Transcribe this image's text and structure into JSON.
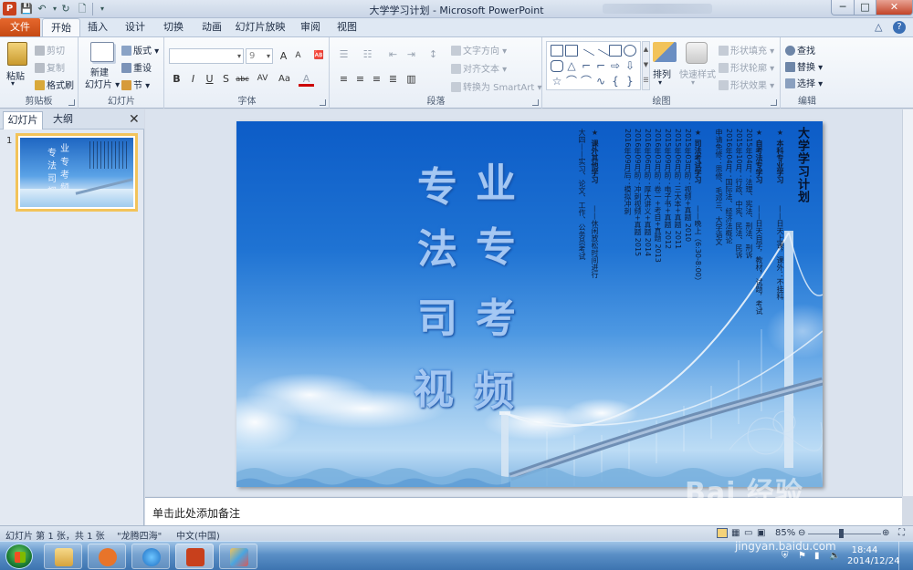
{
  "window": {
    "title": "大学学习计划 - Microsoft PowerPoint",
    "app_icon": "P",
    "controls": {
      "minimize": "─",
      "maximize": "□",
      "close": "✕"
    }
  },
  "qat": {
    "save": "💾",
    "undo": "↶",
    "undo_dd": "▾",
    "redo": "↻",
    "new": "🗋",
    "customize": "▾"
  },
  "tabs": [
    "文件",
    "开始",
    "插入",
    "设计",
    "切换",
    "动画",
    "幻灯片放映",
    "审阅",
    "视图"
  ],
  "active_tab": "开始",
  "ribbon_right": {
    "collapse": "△",
    "help": "?"
  },
  "ribbon": {
    "clipboard": {
      "label": "剪贴板",
      "paste": "粘贴",
      "cut": "剪切",
      "copy": "复制",
      "format_painter": "格式刷"
    },
    "slides": {
      "label": "幻灯片",
      "new_slide_1": "新建",
      "new_slide_2": "幻灯片",
      "layout": "版式",
      "reset": "重设",
      "section": "节"
    },
    "font": {
      "label": "字体",
      "font_name": "",
      "font_size": "9",
      "grow": "A",
      "shrink": "A",
      "clear": "🆎",
      "bold": "B",
      "italic": "I",
      "underline": "U",
      "shadow": "S",
      "strike": "abc",
      "spacing": "AV",
      "case": "Aa",
      "color": "A"
    },
    "paragraph": {
      "label": "段落",
      "text_direction": "文字方向",
      "align_text": "对齐文本",
      "smartart": "转换为 SmartArt"
    },
    "drawing": {
      "label": "绘图",
      "arrange": "排列",
      "quick_styles": "快速样式",
      "shape_fill": "形状填充",
      "shape_outline": "形状轮廓",
      "shape_effects": "形状效果"
    },
    "editing": {
      "label": "编辑",
      "find": "查找",
      "replace": "替换",
      "select": "选择"
    }
  },
  "panel": {
    "tab_slides": "幻灯片",
    "tab_outline": "大纲",
    "close": "✕",
    "slide_number": "1"
  },
  "slide": {
    "left_chars": [
      "专",
      "法",
      "司",
      "视"
    ],
    "right_chars": [
      "业",
      "专",
      "考",
      "频"
    ],
    "title": "大学学习计划",
    "sections": [
      {
        "heading": "★ 本科专业学习",
        "lines": [
          "——日天上课，课外：不挂科"
        ]
      },
      {
        "heading": "★ 自考法专学习",
        "lines": [
          "——日天自学，教材，试题，考试",
          "2015年04月：法理、宪法、刑法、刑诉",
          "2015年10月：行政、中宪、民法、民诉",
          "2016年04月：国际法、经济法概论",
          "申请免修：思修、毛邓三、大学语文"
        ]
      },
      {
        "heading": "★ 司法考试学习",
        "lines": [
          "——晚上（6:30-8:00）",
          "2015年03月前：视频+真题 2010",
          "2015年06月前：三大本+真题 2011",
          "2015年09月前：电子书+真题 2012",
          "2016年03月前：卷一+考目+真题 2013",
          "2016年06月前：厚大讲义+真题 2014",
          "2016年09月前：冲刺视频+真题 2015",
          "2016年09月后：模拟冲刺"
        ]
      },
      {
        "heading": "★ 课外其他学习",
        "lines": [
          "——休闲放松时间进行",
          "大四——实习、论文、工作、公务员考试"
        ]
      }
    ]
  },
  "notes": {
    "placeholder": "单击此处添加备注"
  },
  "status": {
    "slide_info": "幻灯片 第 1 张，共 1 张",
    "theme": "\"龙腾四海\"",
    "language": "中文(中国)",
    "zoom": "85%"
  },
  "taskbar": {
    "time": "18:44",
    "date": "2014/12/24"
  },
  "watermark": {
    "main": "Bai 经验",
    "sub": "jingyan.baidu.com"
  },
  "colors": {
    "file_tab": "#d2571d",
    "slide_sky": "#1f73d3",
    "selection": "#f2c35a"
  }
}
